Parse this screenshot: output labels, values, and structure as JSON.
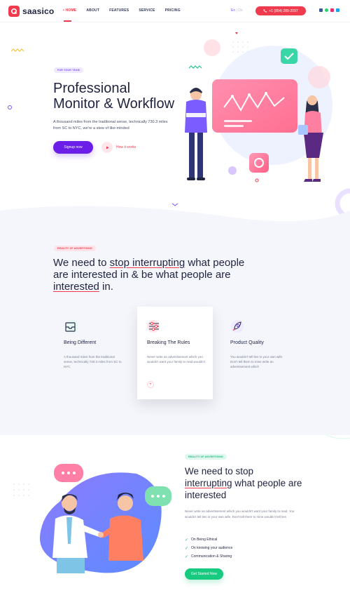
{
  "brand": {
    "name": "saasico"
  },
  "nav": {
    "items": [
      "• HOME",
      "ABOUT",
      "FEATURES",
      "SERVICE",
      "PRICING"
    ]
  },
  "lang": {
    "active": "En",
    "separator": " | ",
    "other": "Dn"
  },
  "header": {
    "phone": "+1 (854) 289-2097",
    "social_icons": [
      "facebook-icon",
      "whatsapp-icon",
      "instagram-icon",
      "twitter-icon"
    ]
  },
  "hero": {
    "tag": "FOR YOUR TEAM",
    "title_line1": "Professional",
    "title_line2": "Monitor & Workflow",
    "text": "A thousand miles from the traditional sense, technically 730.3 miles from SC to NYC, we're a stew of like-minded",
    "signup": "Signup now",
    "how": "How it works"
  },
  "section2": {
    "tag": "REALITY OF ADVERTISING",
    "title_a": "We need to ",
    "title_b": "stop interrupting",
    "title_c": " what people are interested in & be what people are ",
    "title_d": "interested",
    "title_e": " in.",
    "features": [
      {
        "title": "Being Different",
        "text": "A thousand miles from the traditional sense, technically 730.3 miles from SC to NYC",
        "icon": "inbox-icon"
      },
      {
        "title": "Breaking The Rules",
        "text": "Never write an advertisement which you wouldn't want your family to read.wouldn't",
        "icon": "sliders-icon",
        "plus": "+"
      },
      {
        "title": "Product Quality",
        "text": "You wouldn't tell lies to your own wife. Don't tell them to mine write an advertisement which",
        "icon": "rocket-icon"
      }
    ]
  },
  "section3": {
    "tag": "REALITY OF ADVERTISING",
    "title_a": "We need to stop",
    "title_b": "interrupting",
    "title_c": " what people are interested",
    "text": "Never write an advertisement which you wouldn't want your family to read. You wouldn't tell lies to your own wife. Don't tell them to mine wouldn't tell lies",
    "checks": [
      "On Being Ethical",
      "On knowing your audience",
      "Communication & Sharing"
    ],
    "button": "Get Started Now"
  },
  "colors": {
    "accent": "#ef3b4d",
    "primary": "#6a1ee8",
    "success": "#18c980",
    "text": "#1f2340"
  }
}
